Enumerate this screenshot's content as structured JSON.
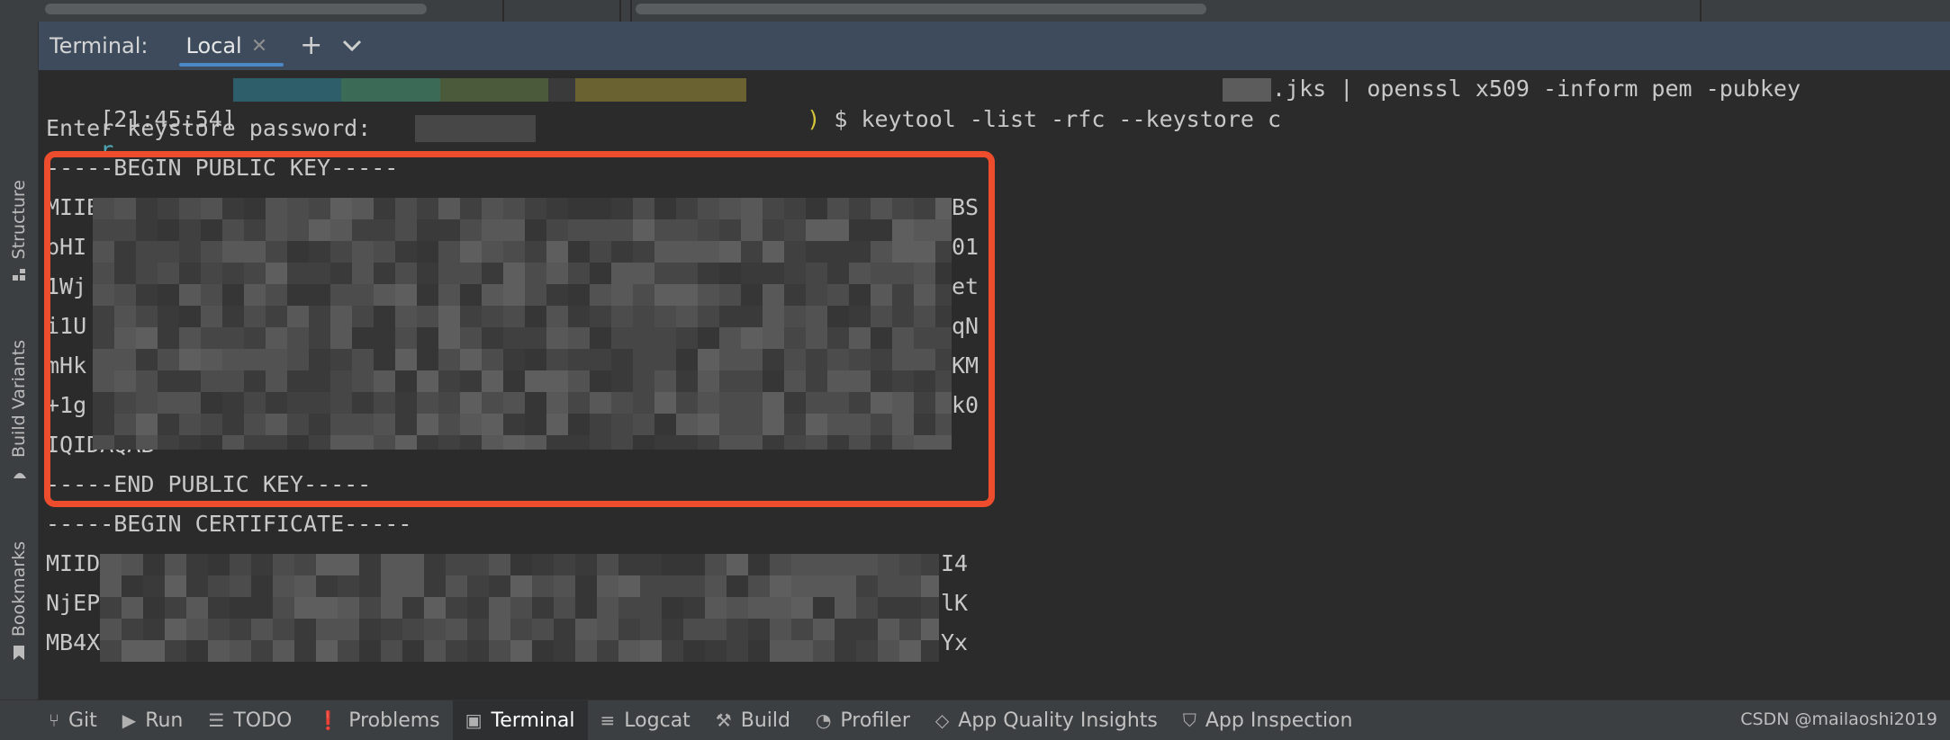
{
  "terminal": {
    "title": "Terminal:",
    "tab_label": "Local",
    "tab_close": "✕",
    "new_tab": "+",
    "dropdown": "⌄"
  },
  "side_tabs": [
    {
      "label": "Structure"
    },
    {
      "label": "Build Variants"
    },
    {
      "label": "Bookmarks"
    }
  ],
  "lines": {
    "prompt_time": "[21:45:54]",
    "prompt_user": "r",
    "prompt_end": ")",
    "command_pre": "$ keytool -list -rfc --keystore c",
    "command_post": ".jks | openssl x509 -inform pem -pubkey",
    "password": "Enter keystore password:",
    "begin_pub": "-----BEGIN PUBLIC KEY-----",
    "k1_left": "MIIB",
    "k1_right": "BS",
    "k2_left": "pHI",
    "k2_right": "01",
    "k3_left": "1Wj",
    "k3_right": "et",
    "k4_left": "i1U",
    "k4_right": "qN",
    "k5_left": "mHk",
    "k5_right": "KM",
    "k6_left": "+1g",
    "k6_right": "k0",
    "k7_left": "IQIDAQAB",
    "end_pub": "-----END PUBLIC KEY-----",
    "begin_cert": "-----BEGIN CERTIFICATE-----",
    "c1_left": "MIID",
    "c1_right": "I4",
    "c2_left": "NjEP",
    "c2_right": "lK",
    "c3_left": "MB4X",
    "c3_right": "Yx"
  },
  "bottom_tabs": [
    {
      "label": "Git",
      "icon": "branch-icon",
      "glyph": "⑂"
    },
    {
      "label": "Run",
      "icon": "play-icon",
      "glyph": "▶"
    },
    {
      "label": "TODO",
      "icon": "list-icon",
      "glyph": "☰"
    },
    {
      "label": "Problems",
      "icon": "alert-icon",
      "glyph": "❗"
    },
    {
      "label": "Terminal",
      "icon": "terminal-icon",
      "glyph": "▣"
    },
    {
      "label": "Logcat",
      "icon": "logcat-icon",
      "glyph": "≡"
    },
    {
      "label": "Build",
      "icon": "hammer-icon",
      "glyph": "⚒"
    },
    {
      "label": "Profiler",
      "icon": "gauge-icon",
      "glyph": "◔"
    },
    {
      "label": "App Quality Insights",
      "icon": "diamond-icon",
      "glyph": "◇"
    },
    {
      "label": "App Inspection",
      "icon": "inspect-icon",
      "glyph": "⛉"
    }
  ],
  "active_bottom_tab": "Terminal",
  "watermark": "CSDN @mailaoshi2019",
  "colors": {
    "header_bg": "#3d4b5c",
    "highlight_box": "#ee4d2d",
    "tab_underline": "#4a88c7",
    "prompt_user": "#4ea6b5",
    "prompt_paren": "#d6c43a"
  }
}
